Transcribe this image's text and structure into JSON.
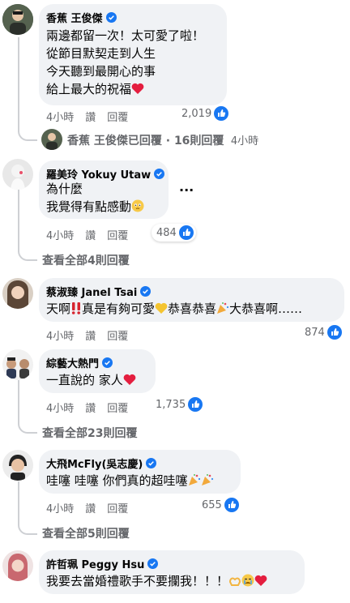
{
  "comments": [
    {
      "name": "香蕉 王俊傑",
      "lines": [
        "兩邊都留一次！太可愛了啦！",
        "從節目默契走到人生",
        "今天聽到最開心的事",
        "給上最大的祝福"
      ],
      "time": "4小時",
      "like": "讚",
      "reply": "回覆",
      "count": "2,019",
      "reply_summary": {
        "name": "香蕉 王俊傑",
        "text": "已回覆 · 16則回覆",
        "time": "4小時"
      }
    },
    {
      "name": "羅美玲 Yokuy Utaw",
      "lines": [
        "為什麼",
        "我覺得有點感動"
      ],
      "more": "···",
      "time": "4小時",
      "like": "讚",
      "reply": "回覆",
      "count": "484",
      "view_all": "查看全部4則回覆"
    },
    {
      "name": "蔡淑臻 Janel Tsai",
      "text_a": "天啊",
      "text_b": "真是有夠可愛",
      "text_c": "恭喜恭喜",
      "text_d": "大恭喜啊……",
      "time": "4小時",
      "like": "讚",
      "reply": "回覆",
      "count": "874"
    },
    {
      "name": "綜藝大熱門",
      "line": "一直說的 家人",
      "time": "4小時",
      "like": "讚",
      "reply": "回覆",
      "count": "1,735",
      "view_all": "查看全部23則回覆"
    },
    {
      "name": "大飛McFly(吳志慶)",
      "line": "哇噻 哇噻 你們真的超哇噻",
      "time": "4小時",
      "like": "讚",
      "reply": "回覆",
      "count": "655",
      "view_all": "查看全部5則回覆"
    },
    {
      "name": "許哲珮 Peggy Hsu",
      "line": "我要去當婚禮歌手不要攔我！！！"
    }
  ],
  "colors": {
    "bubble": "#f0f2f5",
    "verified": "#1877f2",
    "meta": "#65676b",
    "heart": "#e41e3f"
  },
  "icons": [
    "verified-badge-icon",
    "like-thumb-icon",
    "heart-emoji",
    "double-exclamation-emoji",
    "yellow-heart-emoji",
    "party-popper-emoji",
    "teary-face-emoji",
    "heart-hands-emoji",
    "crying-face-emoji"
  ]
}
